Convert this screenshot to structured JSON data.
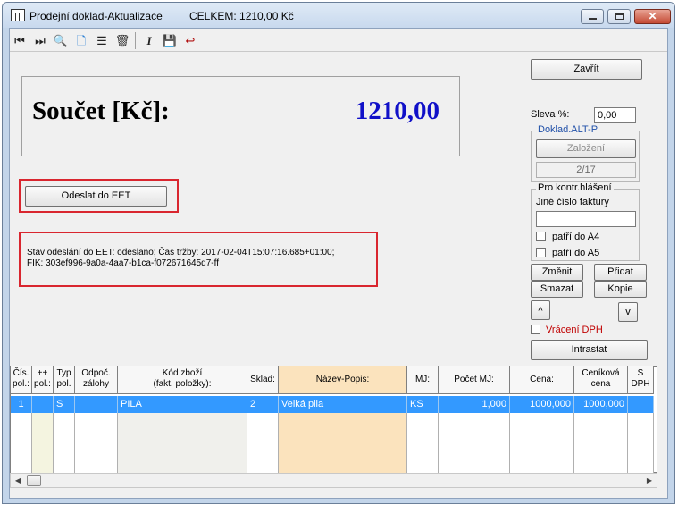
{
  "window": {
    "title": "Prodejní doklad-Aktualizace",
    "total": "CELKEM: 1210,00 Kč",
    "close_glyph": "✕"
  },
  "toolbar": {
    "icons": [
      "first-record-icon",
      "last-record-icon",
      "search-icon",
      "new-document-icon",
      "list-icon",
      "delete-icon",
      "italic-icon",
      "save-icon",
      "undo-icon"
    ],
    "glyphs": {
      "first": "⏮",
      "last": "⏭",
      "search": "🔍",
      "new": "🗋",
      "list": "☰",
      "delete": "🗑",
      "italic": "I",
      "save": "💾",
      "undo": "↩"
    }
  },
  "sum": {
    "label": "Součet [Kč]:",
    "value": "1210,00"
  },
  "eet": {
    "send_button": "Odeslat do EET",
    "status_text": "Stav odeslání do EET: odeslano; Čas tržby: 2017-02-04T15:07:16.685+01:00;\nFIK: 303ef996-9a0a-4aa7-b1ca-f072671645d7-ff"
  },
  "right": {
    "close_button": "Zavřít",
    "discount_label": "Sleva %:",
    "discount_value": "0,00",
    "doklad_group": "Doklad.ALT-P",
    "zalozeni_button": "Založení",
    "counter": "2/17",
    "kontrol_group": "Pro kontr.hlášení",
    "jine_cislo_label": "Jiné číslo faktury",
    "jine_cislo_value": "",
    "patri_a4": "patří do A4",
    "patri_a5": "patří do A5",
    "zmenit": "Změnit",
    "pridat": "Přidat",
    "smazat": "Smazat",
    "kopie": "Kopie",
    "up": "^",
    "down": "v",
    "vraceni_dph": "Vrácení DPH",
    "intrastat": "Intrastat"
  },
  "grid": {
    "headers": [
      "Čís.\npol.:",
      "++\npol.:",
      "Typ\npol.",
      "Odpoč.\nzálohy",
      "Kód zboží\n(fakt. položky):",
      "Sklad:",
      "Název-Popis:",
      "MJ:",
      "Počet MJ:",
      "Cena:",
      "Ceníková\ncena",
      "S\nDPH"
    ],
    "row": [
      "1",
      "",
      "S",
      "",
      "PILA",
      "2",
      "Velká pila",
      "KS",
      "1,000",
      "1000,000",
      "1000,000",
      ""
    ]
  },
  "scroll": {
    "left_arrow": "◀",
    "right_arrow": "▶"
  },
  "colors": {
    "accent_blue": "#1010c8",
    "selection": "#3399ff",
    "highlight_red": "#d9262f",
    "vraceni_red": "#c00000"
  }
}
